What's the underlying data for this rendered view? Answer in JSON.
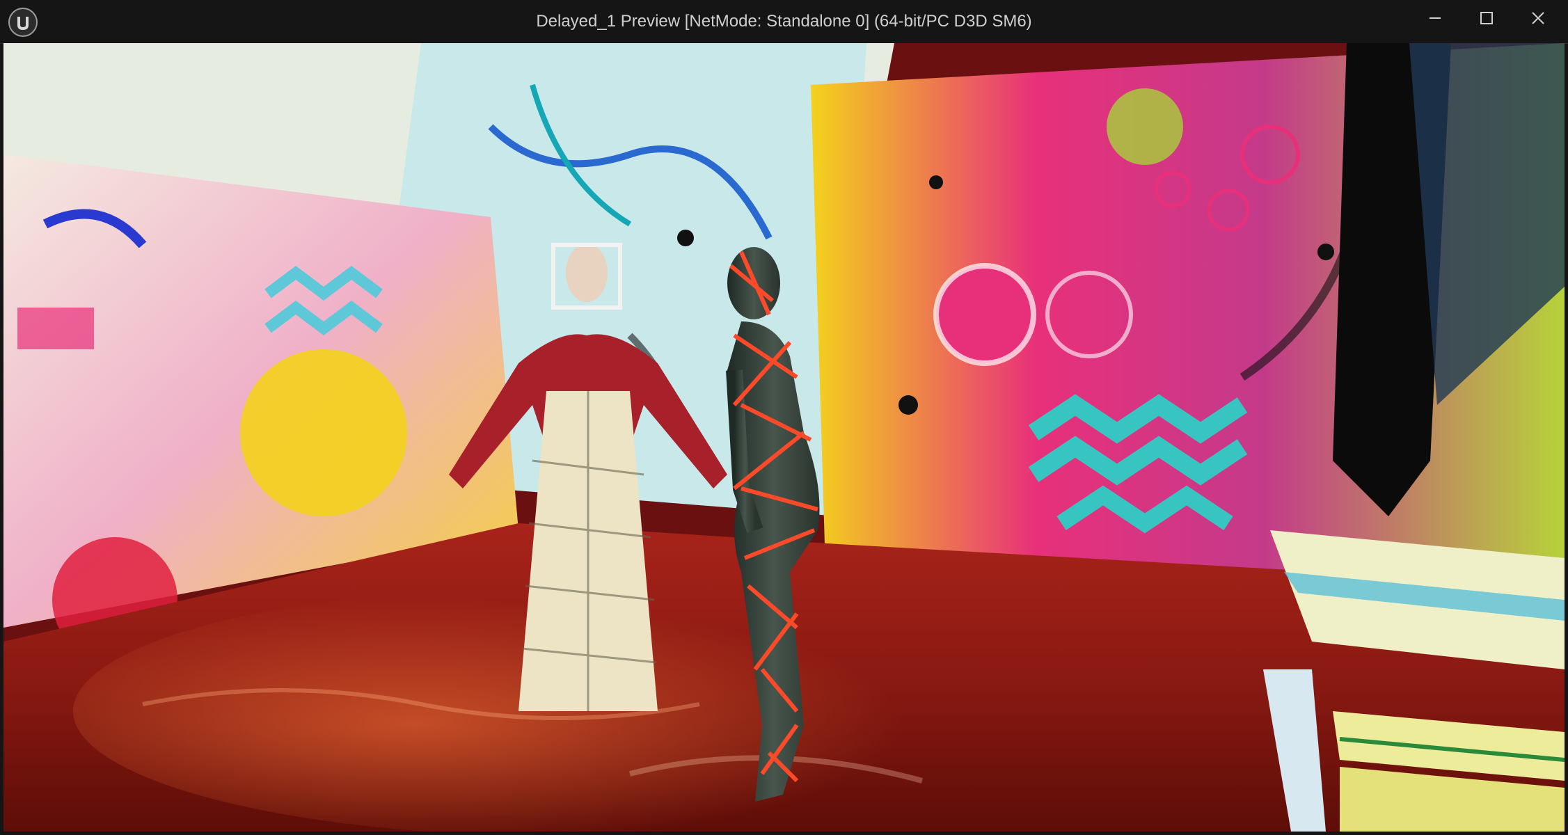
{
  "window": {
    "title": "Delayed_1 Preview [NetMode: Standalone 0]  (64-bit/PC D3D SM6)",
    "app_icon": "unreal-engine-logo-icon",
    "controls": {
      "minimize_icon": "minimize-icon",
      "maximize_icon": "maximize-icon",
      "close_icon": "close-icon"
    }
  },
  "viewport": {
    "scene": "game-viewport",
    "colors": {
      "floor": "#8a1a12",
      "wall_left": "#f2e6d8",
      "accent_magenta": "#e8307a",
      "accent_yellow": "#f3d21c",
      "accent_teal": "#38c4c0",
      "figure_skin": "#2f3a33",
      "figure_lines": "#ff4a2a",
      "dress": "#ece4c4",
      "jacket": "#a8202a"
    }
  }
}
